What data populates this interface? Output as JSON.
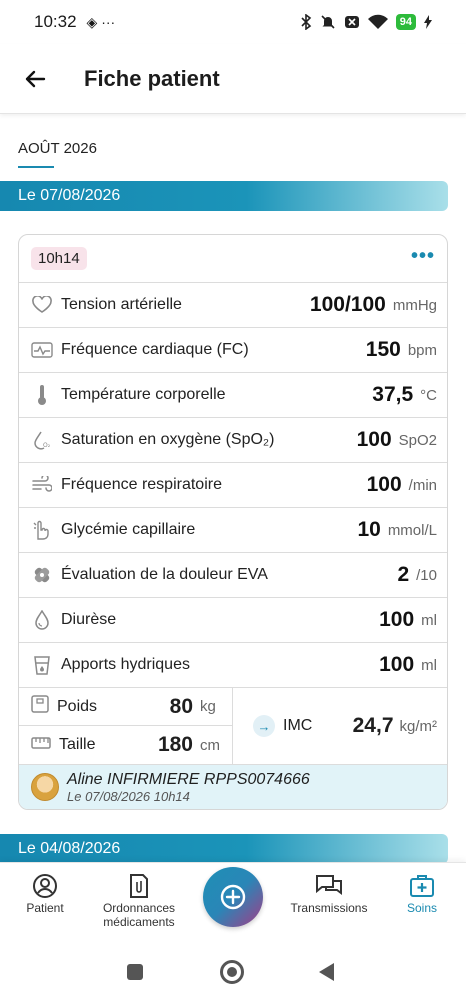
{
  "status_bar": {
    "time": "10:32",
    "extra": "◈ ···",
    "battery": "94"
  },
  "header": {
    "title": "Fiche patient"
  },
  "month": {
    "label": "AOÛT 2026"
  },
  "sections": [
    {
      "date": "Le 07/08/2026"
    },
    {
      "date": "Le 04/08/2026"
    }
  ],
  "entry": {
    "time": "10h14",
    "more_icon": "•••",
    "rows": [
      {
        "label": "Tension artérielle",
        "value": "100/100",
        "unit": "mmHg",
        "icon": "heart-icon"
      },
      {
        "label": "Fréquence cardiaque (FC)",
        "value": "150",
        "unit": "bpm",
        "icon": "heartbeat-icon"
      },
      {
        "label": "Température corporelle",
        "value": "37,5",
        "unit": "°C",
        "icon": "thermometer-icon"
      },
      {
        "label": "Saturation en oxygène (SpO₂)",
        "value": "100",
        "unit": "SpO2",
        "icon": "oxygen-drop-icon"
      },
      {
        "label": "Fréquence respiratoire",
        "value": "100",
        "unit": "/min",
        "icon": "wind-icon"
      },
      {
        "label": "Glycémie capillaire",
        "value": "10",
        "unit": "mmol/L",
        "icon": "finger-prick-icon"
      },
      {
        "label": "Évaluation de la douleur EVA",
        "value": "2",
        "unit": "/10",
        "icon": "bandage-icon"
      },
      {
        "label": "Diurèse",
        "value": "100",
        "unit": "ml",
        "icon": "drop-icon"
      },
      {
        "label": "Apports hydriques",
        "value": "100",
        "unit": "ml",
        "icon": "cup-icon"
      }
    ],
    "poids": {
      "label": "Poids",
      "value": "80",
      "unit": "kg"
    },
    "taille": {
      "label": "Taille",
      "value": "180",
      "unit": "cm"
    },
    "imc": {
      "label": "IMC",
      "value": "24,7",
      "unit": "kg/m²"
    },
    "author": {
      "name": "Aline INFIRMIERE RPPS0074666",
      "date": "Le 07/08/2026 10h14"
    }
  },
  "bottom_nav": {
    "patient": "Patient",
    "ordonnances": "Ordonnances\nmédicaments",
    "transmissions": "Transmissions",
    "soins": "Soins"
  },
  "colors": {
    "accent": "#1a8ab0",
    "chip": "#f8e3ea",
    "author_bg": "#e1f3f8"
  }
}
